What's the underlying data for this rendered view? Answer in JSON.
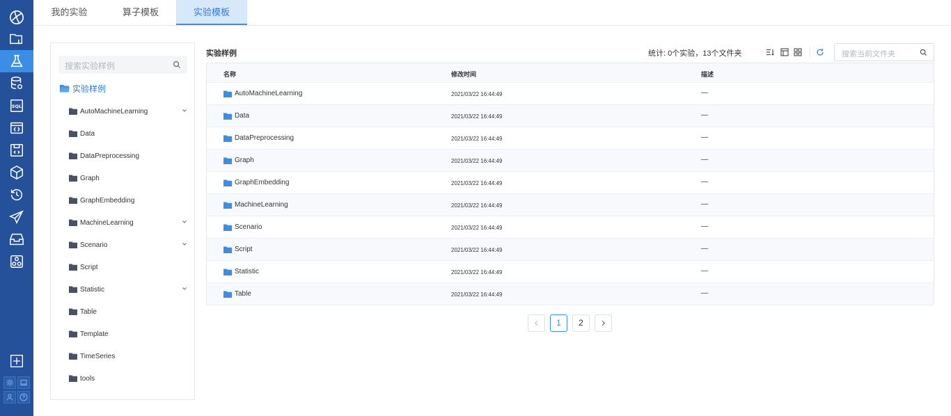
{
  "tabs": [
    "我的实验",
    "算子模板",
    "实验模板"
  ],
  "active_tab": 2,
  "sidebar_icons": [
    "logo-icon",
    "project-folder-icon",
    "experiment-flask-icon",
    "database-icon",
    "sql-icon",
    "code-window-icon",
    "notebook-icon",
    "model-cube-icon",
    "history-icon",
    "deploy-send-icon",
    "inbox-icon",
    "cluster-icon"
  ],
  "sidebar_bottom_icons": [
    "add-icon",
    "settings-icon",
    "laptop-icon",
    "user-icon",
    "help-icon"
  ],
  "tree": {
    "search_placeholder": "搜索实验样例",
    "root_label": "实验样例",
    "items": [
      {
        "label": "AutoMachineLearning",
        "expandable": true
      },
      {
        "label": "Data",
        "expandable": false
      },
      {
        "label": "DataPreprocessing",
        "expandable": false
      },
      {
        "label": "Graph",
        "expandable": false
      },
      {
        "label": "GraphEmbedding",
        "expandable": false
      },
      {
        "label": "MachineLearning",
        "expandable": true
      },
      {
        "label": "Scenario",
        "expandable": true
      },
      {
        "label": "Script",
        "expandable": false
      },
      {
        "label": "Statistic",
        "expandable": true
      },
      {
        "label": "Table",
        "expandable": false
      },
      {
        "label": "Template",
        "expandable": false
      },
      {
        "label": "TimeSeries",
        "expandable": false
      },
      {
        "label": "tools",
        "expandable": false
      }
    ]
  },
  "main": {
    "title": "实验样例",
    "stats": "统计: 0个实验，13个文件夹",
    "search_placeholder": "搜索当前文件夹",
    "toolbar_icons": [
      "sort-icon",
      "list-view-icon",
      "grid-view-icon",
      "refresh-icon"
    ],
    "columns": {
      "name": "名称",
      "modified": "修改时间",
      "desc": "描述"
    },
    "rows": [
      {
        "name": "AutoMachineLearning",
        "time": "2021/03/22 16:44:49",
        "desc": "—"
      },
      {
        "name": "Data",
        "time": "2021/03/22 16:44:49",
        "desc": "—"
      },
      {
        "name": "DataPreprocessing",
        "time": "2021/03/22 16:44:49",
        "desc": "—"
      },
      {
        "name": "Graph",
        "time": "2021/03/22 16:44:49",
        "desc": "—"
      },
      {
        "name": "GraphEmbedding",
        "time": "2021/03/22 16:44:49",
        "desc": "—"
      },
      {
        "name": "MachineLearning",
        "time": "2021/03/22 16:44:49",
        "desc": "—"
      },
      {
        "name": "Scenario",
        "time": "2021/03/22 16:44:49",
        "desc": "—"
      },
      {
        "name": "Script",
        "time": "2021/03/22 16:44:49",
        "desc": "—"
      },
      {
        "name": "Statistic",
        "time": "2021/03/22 16:44:49",
        "desc": "—"
      },
      {
        "name": "Table",
        "time": "2021/03/22 16:44:49",
        "desc": "—"
      }
    ]
  },
  "pagination": {
    "pages": [
      "1",
      "2"
    ],
    "current": "1"
  },
  "colors": {
    "rail": "#25509a",
    "accent": "#3b8ee6",
    "folder_dark": "#4a5160",
    "folder_blue": "#3b8ee6"
  }
}
